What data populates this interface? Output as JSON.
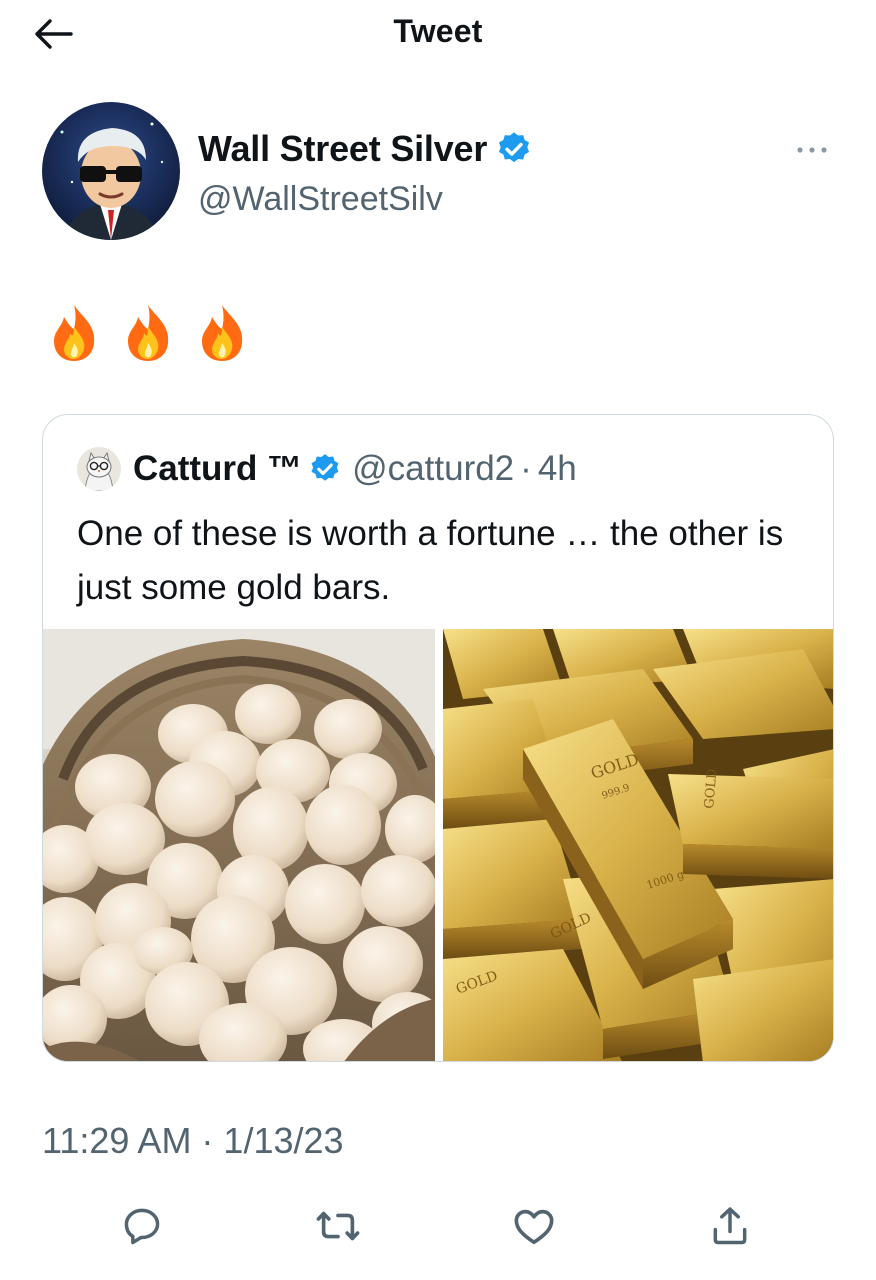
{
  "header": {
    "title": "Tweet",
    "back_icon": "arrow-left-icon"
  },
  "author": {
    "display_name": "Wall Street Silver",
    "handle": "@WallStreetSilv",
    "verified_icon": "verified-badge-icon",
    "more_icon": "more-horizontal-icon"
  },
  "tweet": {
    "emojis": [
      "fire-emoji",
      "fire-emoji",
      "fire-emoji"
    ]
  },
  "quoted_tweet": {
    "display_name": "Catturd ™",
    "verified_icon": "verified-badge-icon",
    "handle": "@catturd2",
    "separator": "·",
    "time": "4h",
    "text": "One of these is worth a fortune … the other is just some gold bars.",
    "media": [
      {
        "name": "basket-of-eggs-image"
      },
      {
        "name": "gold-bars-image"
      }
    ]
  },
  "timestamp": "11:29 AM · 1/13/23",
  "actions": [
    {
      "name": "reply-icon"
    },
    {
      "name": "retweet-icon"
    },
    {
      "name": "like-icon"
    },
    {
      "name": "share-icon"
    }
  ],
  "colors": {
    "verified": "#1d9bf0",
    "secondary_text": "#536471",
    "border": "#cfd9de",
    "gold": "#c9a237"
  }
}
